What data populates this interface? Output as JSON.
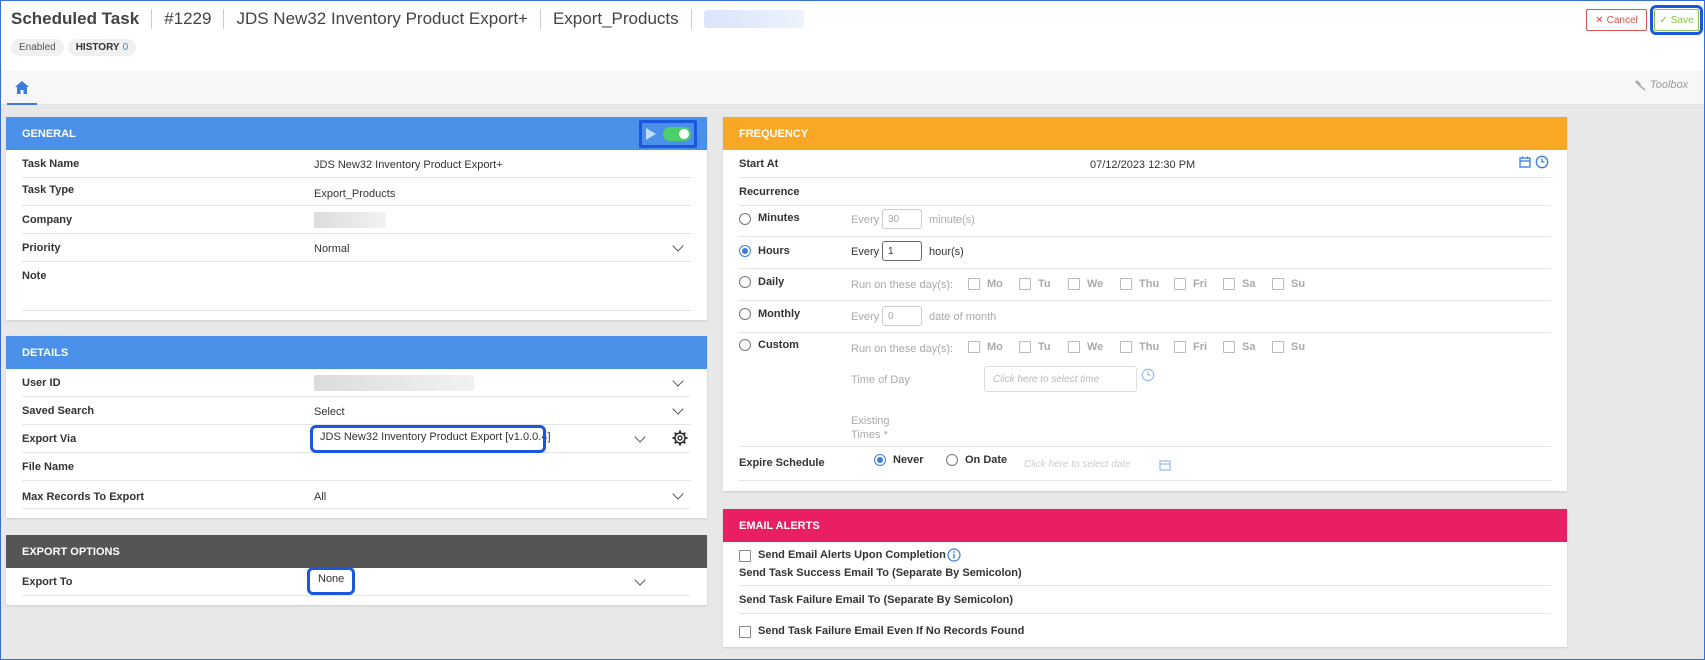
{
  "header": {
    "title": "Scheduled Task",
    "id": "#1229",
    "name": "JDS New32 Inventory Product Export+",
    "type": "Export_Products",
    "status_badge": "Enabled",
    "history_label": "HISTORY",
    "history_count": "0",
    "cancel_label": "Cancel",
    "save_label": "Save"
  },
  "tabs": {
    "toolbox_label": "Toolbox"
  },
  "general": {
    "heading": "GENERAL",
    "task_name_label": "Task Name",
    "task_name": "JDS New32 Inventory Product Export+",
    "task_type_label": "Task Type",
    "task_type": "Export_Products",
    "company_label": "Company",
    "priority_label": "Priority",
    "priority": "Normal",
    "note_label": "Note"
  },
  "details": {
    "heading": "DETAILS",
    "user_id_label": "User ID",
    "saved_search_label": "Saved Search",
    "saved_search": "Select",
    "export_via_label": "Export Via",
    "export_via": "JDS New32 Inventory Product Export [v1.0.0.4]",
    "file_name_label": "File Name",
    "max_records_label": "Max Records To Export",
    "max_records": "All"
  },
  "export_options": {
    "heading": "EXPORT OPTIONS",
    "export_to_label": "Export To",
    "export_to": "None"
  },
  "frequency": {
    "heading": "FREQUENCY",
    "start_at_label": "Start At",
    "start_at": "07/12/2023 12:30 PM",
    "recurrence_label": "Recurrence",
    "every": "Every",
    "minutes_label": "Minutes",
    "minutes_value": "30",
    "minutes_unit": "minute(s)",
    "hours_label": "Hours",
    "hours_value": "1",
    "hours_unit": "hour(s)",
    "daily_label": "Daily",
    "run_days": "Run on these day(s):",
    "days": [
      "Mo",
      "Tu",
      "We",
      "Thu",
      "Fri",
      "Sa",
      "Su"
    ],
    "monthly_label": "Monthly",
    "monthly_value": "0",
    "monthly_unit": "date of month",
    "custom_label": "Custom",
    "time_of_day_label": "Time of Day",
    "time_placeholder": "Click here to select time",
    "existing_times_label": "Existing",
    "existing_times_label2": "Times *",
    "expire_label": "Expire Schedule",
    "never_label": "Never",
    "on_date_label": "On Date",
    "date_placeholder": "Click here to select date"
  },
  "email_alerts": {
    "heading": "EMAIL ALERTS",
    "send_completion": "Send Email Alerts Upon Completion",
    "success_email_label": "Send Task Success Email To (Separate By Semicolon)",
    "failure_email_label": "Send Task Failure Email To (Separate By Semicolon)",
    "failure_no_records": "Send Task Failure Email Even If No Records Found"
  },
  "colors": {
    "general_header": "#4a90e8",
    "export_options_header": "#555555",
    "frequency_header": "#f9a826",
    "email_header": "#e91e63",
    "highlight": "#1a56e0"
  }
}
